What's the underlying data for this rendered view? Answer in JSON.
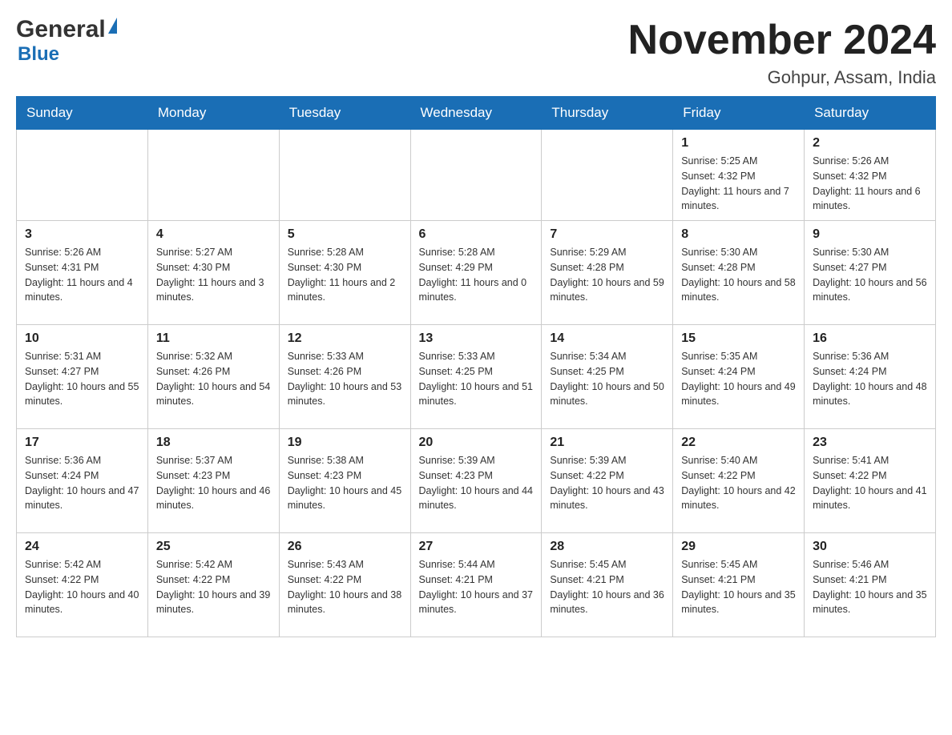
{
  "header": {
    "logo_main": "General",
    "logo_sub": "Blue",
    "month_title": "November 2024",
    "location": "Gohpur, Assam, India"
  },
  "days_of_week": [
    "Sunday",
    "Monday",
    "Tuesday",
    "Wednesday",
    "Thursday",
    "Friday",
    "Saturday"
  ],
  "weeks": [
    [
      {
        "day": "",
        "sunrise": "",
        "sunset": "",
        "daylight": ""
      },
      {
        "day": "",
        "sunrise": "",
        "sunset": "",
        "daylight": ""
      },
      {
        "day": "",
        "sunrise": "",
        "sunset": "",
        "daylight": ""
      },
      {
        "day": "",
        "sunrise": "",
        "sunset": "",
        "daylight": ""
      },
      {
        "day": "",
        "sunrise": "",
        "sunset": "",
        "daylight": ""
      },
      {
        "day": "1",
        "sunrise": "Sunrise: 5:25 AM",
        "sunset": "Sunset: 4:32 PM",
        "daylight": "Daylight: 11 hours and 7 minutes."
      },
      {
        "day": "2",
        "sunrise": "Sunrise: 5:26 AM",
        "sunset": "Sunset: 4:32 PM",
        "daylight": "Daylight: 11 hours and 6 minutes."
      }
    ],
    [
      {
        "day": "3",
        "sunrise": "Sunrise: 5:26 AM",
        "sunset": "Sunset: 4:31 PM",
        "daylight": "Daylight: 11 hours and 4 minutes."
      },
      {
        "day": "4",
        "sunrise": "Sunrise: 5:27 AM",
        "sunset": "Sunset: 4:30 PM",
        "daylight": "Daylight: 11 hours and 3 minutes."
      },
      {
        "day": "5",
        "sunrise": "Sunrise: 5:28 AM",
        "sunset": "Sunset: 4:30 PM",
        "daylight": "Daylight: 11 hours and 2 minutes."
      },
      {
        "day": "6",
        "sunrise": "Sunrise: 5:28 AM",
        "sunset": "Sunset: 4:29 PM",
        "daylight": "Daylight: 11 hours and 0 minutes."
      },
      {
        "day": "7",
        "sunrise": "Sunrise: 5:29 AM",
        "sunset": "Sunset: 4:28 PM",
        "daylight": "Daylight: 10 hours and 59 minutes."
      },
      {
        "day": "8",
        "sunrise": "Sunrise: 5:30 AM",
        "sunset": "Sunset: 4:28 PM",
        "daylight": "Daylight: 10 hours and 58 minutes."
      },
      {
        "day": "9",
        "sunrise": "Sunrise: 5:30 AM",
        "sunset": "Sunset: 4:27 PM",
        "daylight": "Daylight: 10 hours and 56 minutes."
      }
    ],
    [
      {
        "day": "10",
        "sunrise": "Sunrise: 5:31 AM",
        "sunset": "Sunset: 4:27 PM",
        "daylight": "Daylight: 10 hours and 55 minutes."
      },
      {
        "day": "11",
        "sunrise": "Sunrise: 5:32 AM",
        "sunset": "Sunset: 4:26 PM",
        "daylight": "Daylight: 10 hours and 54 minutes."
      },
      {
        "day": "12",
        "sunrise": "Sunrise: 5:33 AM",
        "sunset": "Sunset: 4:26 PM",
        "daylight": "Daylight: 10 hours and 53 minutes."
      },
      {
        "day": "13",
        "sunrise": "Sunrise: 5:33 AM",
        "sunset": "Sunset: 4:25 PM",
        "daylight": "Daylight: 10 hours and 51 minutes."
      },
      {
        "day": "14",
        "sunrise": "Sunrise: 5:34 AM",
        "sunset": "Sunset: 4:25 PM",
        "daylight": "Daylight: 10 hours and 50 minutes."
      },
      {
        "day": "15",
        "sunrise": "Sunrise: 5:35 AM",
        "sunset": "Sunset: 4:24 PM",
        "daylight": "Daylight: 10 hours and 49 minutes."
      },
      {
        "day": "16",
        "sunrise": "Sunrise: 5:36 AM",
        "sunset": "Sunset: 4:24 PM",
        "daylight": "Daylight: 10 hours and 48 minutes."
      }
    ],
    [
      {
        "day": "17",
        "sunrise": "Sunrise: 5:36 AM",
        "sunset": "Sunset: 4:24 PM",
        "daylight": "Daylight: 10 hours and 47 minutes."
      },
      {
        "day": "18",
        "sunrise": "Sunrise: 5:37 AM",
        "sunset": "Sunset: 4:23 PM",
        "daylight": "Daylight: 10 hours and 46 minutes."
      },
      {
        "day": "19",
        "sunrise": "Sunrise: 5:38 AM",
        "sunset": "Sunset: 4:23 PM",
        "daylight": "Daylight: 10 hours and 45 minutes."
      },
      {
        "day": "20",
        "sunrise": "Sunrise: 5:39 AM",
        "sunset": "Sunset: 4:23 PM",
        "daylight": "Daylight: 10 hours and 44 minutes."
      },
      {
        "day": "21",
        "sunrise": "Sunrise: 5:39 AM",
        "sunset": "Sunset: 4:22 PM",
        "daylight": "Daylight: 10 hours and 43 minutes."
      },
      {
        "day": "22",
        "sunrise": "Sunrise: 5:40 AM",
        "sunset": "Sunset: 4:22 PM",
        "daylight": "Daylight: 10 hours and 42 minutes."
      },
      {
        "day": "23",
        "sunrise": "Sunrise: 5:41 AM",
        "sunset": "Sunset: 4:22 PM",
        "daylight": "Daylight: 10 hours and 41 minutes."
      }
    ],
    [
      {
        "day": "24",
        "sunrise": "Sunrise: 5:42 AM",
        "sunset": "Sunset: 4:22 PM",
        "daylight": "Daylight: 10 hours and 40 minutes."
      },
      {
        "day": "25",
        "sunrise": "Sunrise: 5:42 AM",
        "sunset": "Sunset: 4:22 PM",
        "daylight": "Daylight: 10 hours and 39 minutes."
      },
      {
        "day": "26",
        "sunrise": "Sunrise: 5:43 AM",
        "sunset": "Sunset: 4:22 PM",
        "daylight": "Daylight: 10 hours and 38 minutes."
      },
      {
        "day": "27",
        "sunrise": "Sunrise: 5:44 AM",
        "sunset": "Sunset: 4:21 PM",
        "daylight": "Daylight: 10 hours and 37 minutes."
      },
      {
        "day": "28",
        "sunrise": "Sunrise: 5:45 AM",
        "sunset": "Sunset: 4:21 PM",
        "daylight": "Daylight: 10 hours and 36 minutes."
      },
      {
        "day": "29",
        "sunrise": "Sunrise: 5:45 AM",
        "sunset": "Sunset: 4:21 PM",
        "daylight": "Daylight: 10 hours and 35 minutes."
      },
      {
        "day": "30",
        "sunrise": "Sunrise: 5:46 AM",
        "sunset": "Sunset: 4:21 PM",
        "daylight": "Daylight: 10 hours and 35 minutes."
      }
    ]
  ]
}
